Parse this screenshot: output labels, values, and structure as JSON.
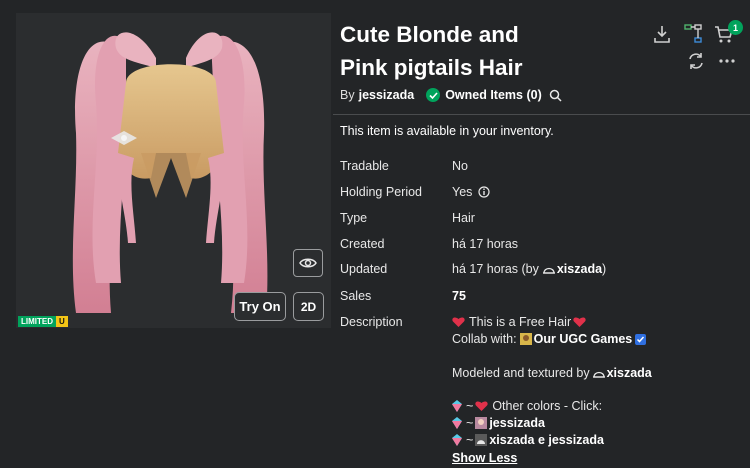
{
  "item": {
    "title_line1": "Cute Blonde and",
    "title_line2": "Pink pigtails Hair",
    "by_prefix": "By",
    "creator": "jessizada",
    "owned_label": "Owned Items (0)",
    "availability": "This item is available in your inventory."
  },
  "preview": {
    "try_on": "Try On",
    "view_2d": "2D",
    "limited_label": "LIMITED",
    "limited_u": "U"
  },
  "header": {
    "cart_count": "1"
  },
  "details": {
    "tradable_label": "Tradable",
    "tradable_value": "No",
    "holding_label": "Holding Period",
    "holding_value": "Yes",
    "type_label": "Type",
    "type_value": "Hair",
    "created_label": "Created",
    "created_value": "há 17 horas",
    "updated_label": "Updated",
    "updated_prefix": "há 17 horas (by",
    "updated_user": "xiszada",
    "updated_suffix": ")",
    "sales_label": "Sales",
    "sales_value": "75",
    "description_label": "Description"
  },
  "description": {
    "line1": "This is a Free Hair",
    "line2_prefix": "Collab with:",
    "line2_group": "Our UGC Games",
    "line3_prefix": "Modeled and textured by",
    "line3_user": "xiszada",
    "line4": "~",
    "line4_text": "Other colors - Click:",
    "line5_user": "jessizada",
    "line6_users": "xiszada e jessizada",
    "show_less": "Show Less"
  },
  "colors": {
    "background": "#232527",
    "preview_bg": "#2b2d2f",
    "accent_green": "#01a35c",
    "limited_yellow": "#f3c516",
    "hair_pink": "#d98a9c",
    "hair_blonde": "#d9b27a",
    "heart_red": "#e0314a",
    "verified_blue": "#2f6fe0"
  },
  "icons": [
    "download-icon",
    "hierarchy-icon",
    "cart-icon",
    "refresh-icon",
    "more-icon",
    "check-icon",
    "search-icon",
    "eye-icon",
    "info-icon",
    "heart-icon",
    "verified-icon",
    "user-icon",
    "diamond-icon"
  ]
}
